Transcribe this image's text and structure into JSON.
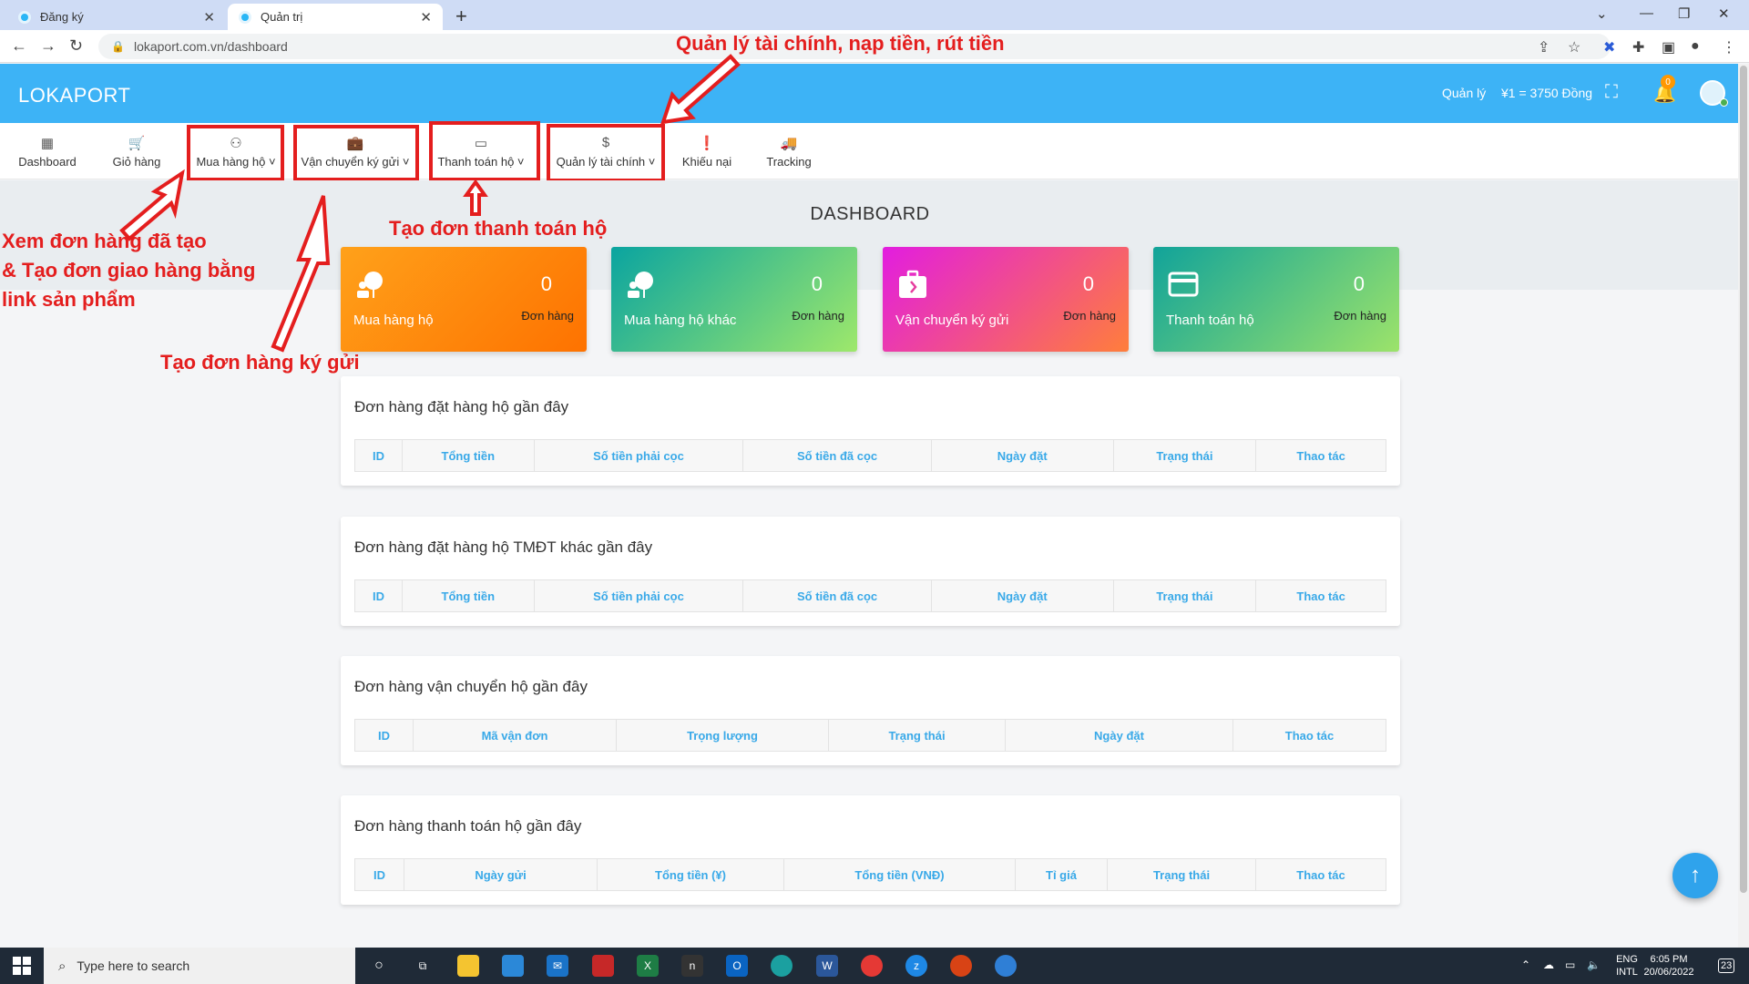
{
  "browser": {
    "tabs": [
      {
        "label": "Đăng ký"
      },
      {
        "label": "Quản trị"
      }
    ],
    "url": "lokaport.com.vn/dashboard"
  },
  "header": {
    "logo": "LOKAPORT",
    "manage_label": "Quản lý",
    "rate": "¥1 = 3750 Đồng",
    "notification_count": "0"
  },
  "menu": {
    "items": [
      {
        "label": "Dashboard",
        "icon": "grid-icon"
      },
      {
        "label": "Giỏ hàng",
        "icon": "cart-icon"
      },
      {
        "label": "Mua hàng hộ",
        "icon": "user-bubble-icon"
      },
      {
        "label": "Vận chuyển ký gửi",
        "icon": "briefcase-icon"
      },
      {
        "label": "Thanh toán hộ",
        "icon": "credit-card-icon"
      },
      {
        "label": "Quản lý tài chính",
        "icon": "dollar-icon"
      },
      {
        "label": "Khiếu nại",
        "icon": "alert-icon"
      },
      {
        "label": "Tracking",
        "icon": "truck-icon"
      }
    ]
  },
  "page": {
    "title": "DASHBOARD"
  },
  "cards": [
    {
      "title": "Mua hàng hộ",
      "value": "0",
      "unit": "Đơn hàng"
    },
    {
      "title": "Mua hàng hộ khác",
      "value": "0",
      "unit": "Đơn hàng"
    },
    {
      "title": "Vận chuyển ký gửi",
      "value": "0",
      "unit": "Đơn hàng"
    },
    {
      "title": "Thanh toán hộ",
      "value": "0",
      "unit": "Đơn hàng"
    }
  ],
  "panels": [
    {
      "title": "Đơn hàng đặt hàng hộ gần đây",
      "columns": [
        "ID",
        "Tổng tiền",
        "Số tiền phải cọc",
        "Số tiền đã cọc",
        "Ngày đặt",
        "Trạng thái",
        "Thao tác"
      ]
    },
    {
      "title": "Đơn hàng đặt hàng hộ TMĐT khác gần đây",
      "columns": [
        "ID",
        "Tổng tiền",
        "Số tiền phải cọc",
        "Số tiền đã cọc",
        "Ngày đặt",
        "Trạng thái",
        "Thao tác"
      ]
    },
    {
      "title": "Đơn hàng vận chuyển hộ gần đây",
      "columns": [
        "ID",
        "Mã vận đơn",
        "Trọng lượng",
        "Trạng thái",
        "Ngày đặt",
        "Thao tác"
      ]
    },
    {
      "title": "Đơn hàng thanh toán hộ gần đây",
      "columns": [
        "ID",
        "Ngày gửi",
        "Tổng tiền (¥)",
        "Tổng tiền (VNĐ)",
        "Tỉ giá",
        "Trạng thái",
        "Thao tác"
      ]
    }
  ],
  "annotations": {
    "finance": "Quản lý tài chính, nạp tiền, rút tiền",
    "payment": "Tạo đơn thanh toán hộ",
    "orders_line1": "Xem đơn hàng đã tạo",
    "orders_line2": "& Tạo đơn giao hàng bằng",
    "orders_line3": "link sản phẩm",
    "consign": "Tạo đơn hàng ký gửi"
  },
  "taskbar": {
    "search_placeholder": "Type here to search",
    "lang_line1": "ENG",
    "lang_line2": "INTL",
    "time": "6:05 PM",
    "date": "20/06/2022",
    "notif_count": "23"
  },
  "colors": {
    "header_blue": "#3db3f6",
    "annotation_red": "#e41e1e",
    "table_header_text": "#39a9e8"
  }
}
